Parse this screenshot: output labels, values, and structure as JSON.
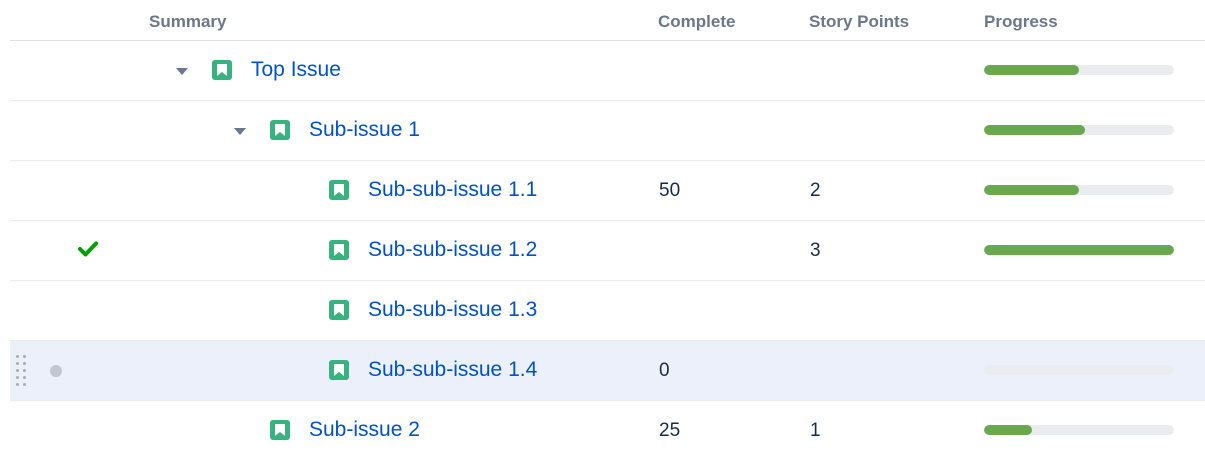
{
  "columns": {
    "summary": "Summary",
    "complete": "Complete",
    "story_points": "Story Points",
    "progress": "Progress"
  },
  "rows": [
    {
      "summary": "Top Issue",
      "complete": "",
      "story_points": "",
      "progress": 0.5,
      "expanded": true,
      "resolved": false
    },
    {
      "summary": "Sub-issue 1",
      "complete": "",
      "story_points": "",
      "progress": 0.53,
      "expanded": true,
      "resolved": false
    },
    {
      "summary": "Sub-sub-issue 1.1",
      "complete": "50",
      "story_points": "2",
      "progress": 0.5,
      "resolved": false
    },
    {
      "summary": "Sub-sub-issue 1.2",
      "complete": "",
      "story_points": "3",
      "progress": 1.0,
      "resolved": true
    },
    {
      "summary": "Sub-sub-issue 1.3",
      "complete": "",
      "story_points": "",
      "progress": null,
      "resolved": false
    },
    {
      "summary": "Sub-sub-issue 1.4",
      "complete": "0",
      "story_points": "",
      "progress": 0.0,
      "resolved": false,
      "hovered": true
    },
    {
      "summary": "Sub-issue 2",
      "complete": "25",
      "story_points": "1",
      "progress": 0.25,
      "resolved": false
    }
  ],
  "icons": {
    "expand": "chevron-down-icon",
    "issue_type": "story-icon",
    "resolved": "check-icon",
    "drag": "drag-handle-icon",
    "status": "status-dot-icon"
  },
  "colors": {
    "issue_link": "#0052cc",
    "story_icon": "#36b37e",
    "progress_fill": "#6aa84f",
    "progress_track": "#ebecf0",
    "check": "#00a000",
    "hover_row": "#ebf0fa",
    "header_text": "#6b778c"
  }
}
